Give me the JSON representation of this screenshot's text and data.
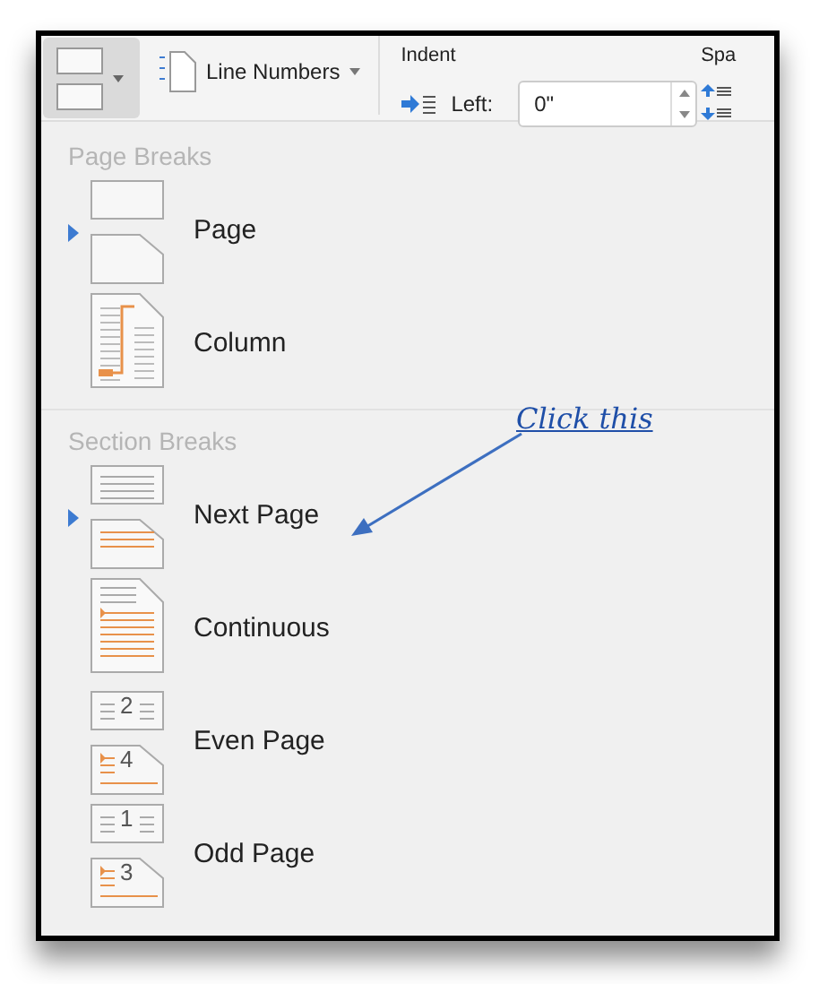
{
  "toolbar": {
    "line_numbers": "Line Numbers",
    "indent_label": "Indent",
    "left_label": "Left:",
    "left_value": "0\"",
    "spacing_label": "Spa"
  },
  "sections": [
    {
      "title": "Page Breaks",
      "items": [
        {
          "kind": "page",
          "label": "Page",
          "selected": true
        },
        {
          "kind": "column",
          "label": "Column",
          "selected": false
        }
      ]
    },
    {
      "title": "Section Breaks",
      "items": [
        {
          "kind": "next_page",
          "label": "Next Page",
          "selected": true
        },
        {
          "kind": "continuous",
          "label": "Continuous",
          "selected": false
        },
        {
          "kind": "even_page",
          "label": "Even Page",
          "selected": false,
          "page_numbers": [
            "2",
            "4"
          ]
        },
        {
          "kind": "odd_page",
          "label": "Odd Page",
          "selected": false,
          "page_numbers": [
            "1",
            "3"
          ]
        }
      ]
    }
  ],
  "annotation": {
    "text": "Click this"
  }
}
